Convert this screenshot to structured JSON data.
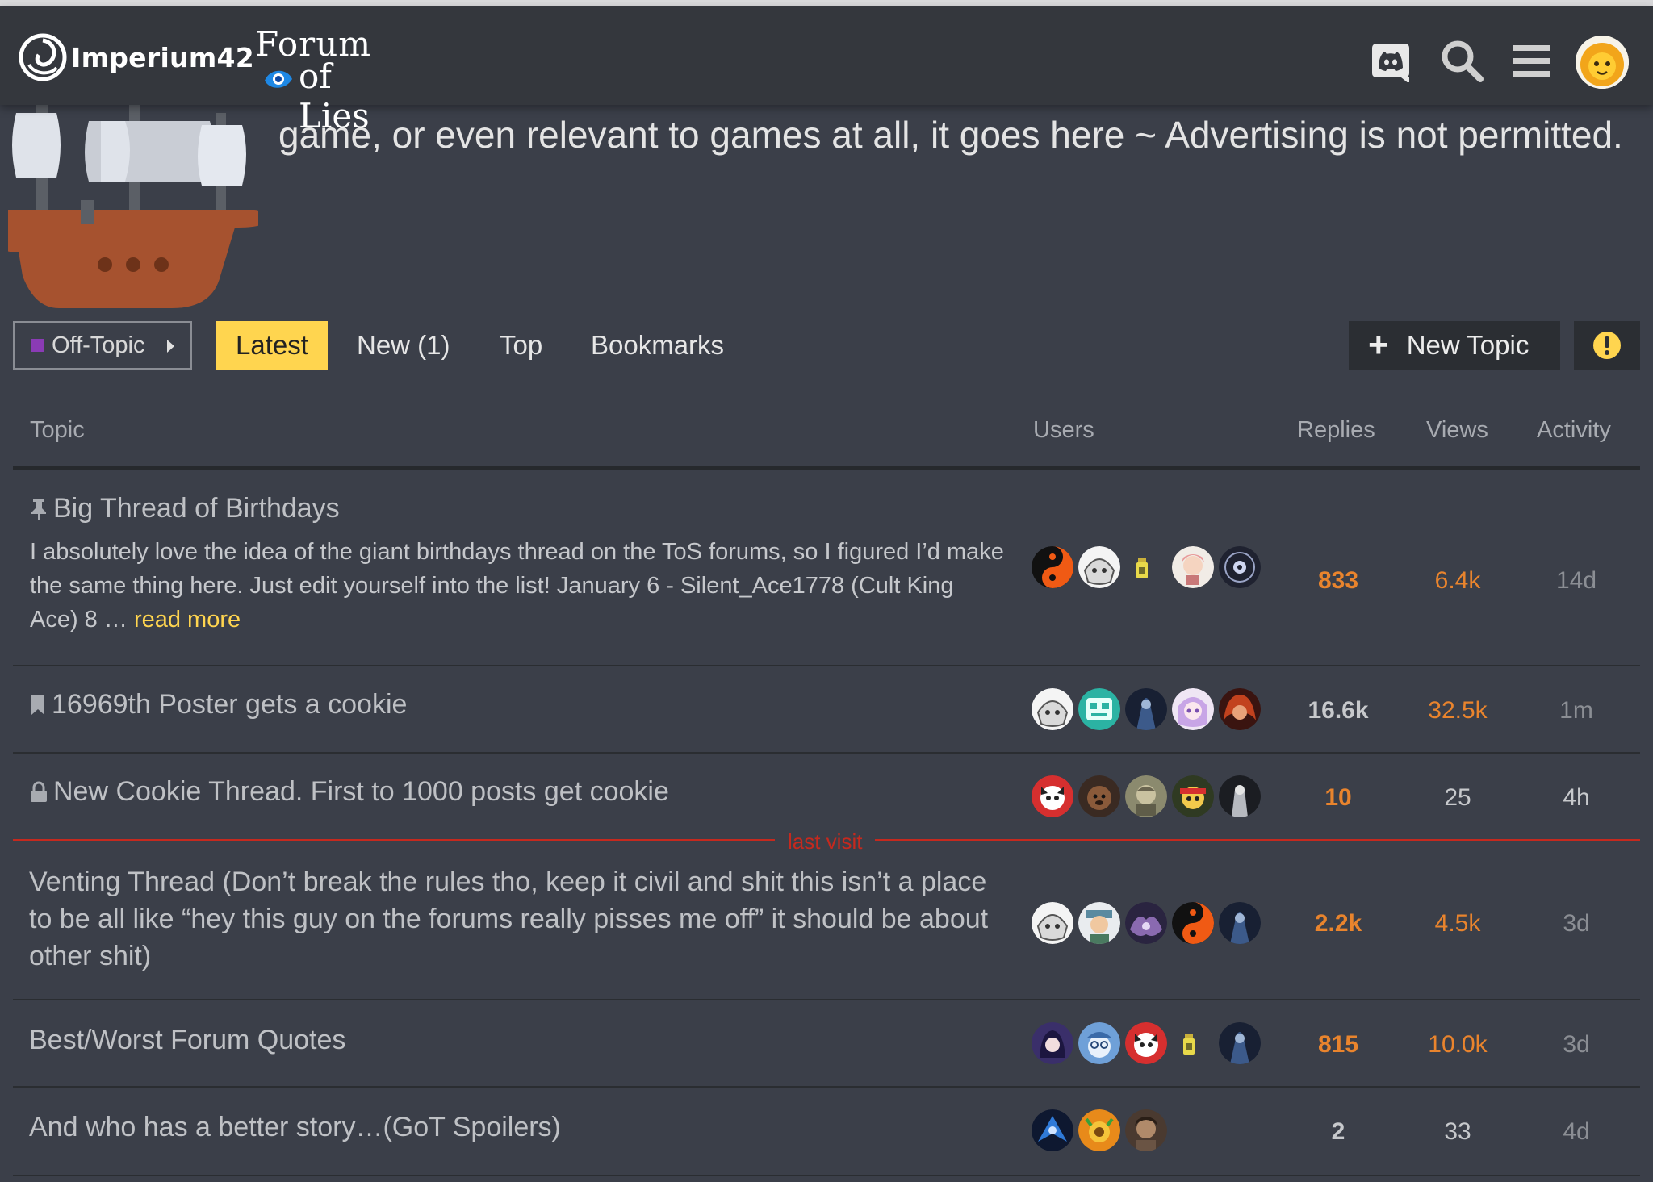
{
  "header": {
    "logo_primary": "Imperium42",
    "logo_secondary_top": "Forum",
    "logo_secondary_bottom": "of Lies",
    "icons": [
      "discord-icon",
      "search-icon",
      "hamburger-menu-icon",
      "user-avatar"
    ]
  },
  "category": {
    "description_visible": "game, or even relevant to games at all, it goes here ~ Advertising is not permitted."
  },
  "nav": {
    "category_dropdown": "Off-Topic",
    "tabs": [
      {
        "label": "Latest",
        "active": true
      },
      {
        "label": "New (1)",
        "active": false
      },
      {
        "label": "Top",
        "active": false
      },
      {
        "label": "Bookmarks",
        "active": false
      }
    ],
    "new_topic_label": "New Topic"
  },
  "table": {
    "headers": {
      "topic": "Topic",
      "users": "Users",
      "replies": "Replies",
      "views": "Views",
      "activity": "Activity"
    },
    "last_visit_label": "last visit",
    "rows": [
      {
        "title": "Big Thread of Birthdays",
        "status_icon": "pin-icon",
        "excerpt": "I absolutely love the idea of the giant birthdays thread on the ToS forums, so I figured I’d make the same thing here. Just edit yourself into the list! January 6 - Silent_Ace1778 (Cult King Ace) 8 …",
        "read_more": "read more",
        "replies": "833",
        "views": "6.4k",
        "activity": "14d"
      },
      {
        "title": "16969th Poster gets a cookie",
        "status_icon": "bookmark-icon",
        "replies": "16.6k",
        "views": "32.5k",
        "activity": "1m"
      },
      {
        "title": "New Cookie Thread. First to 1000 posts get cookie",
        "status_icon": "lock-icon",
        "replies": "10",
        "views": "25",
        "activity": "4h"
      },
      {
        "title": "Venting Thread (Don’t break the rules tho, keep it civil and shit this isn’t a place to be all like “hey this guy on the forums really pisses me off” it should be about other shit)",
        "replies": "2.2k",
        "views": "4.5k",
        "activity": "3d"
      },
      {
        "title": "Best/Worst Forum Quotes",
        "replies": "815",
        "views": "10.0k",
        "activity": "3d"
      },
      {
        "title": "And who has a better story…(GoT Spoilers)",
        "replies": "2",
        "views": "33",
        "activity": "4d"
      }
    ]
  },
  "colors": {
    "background": "#3b3f49",
    "header": "#34373d",
    "accent_yellow": "#ffd54f",
    "hot_orange": "#e9842d",
    "last_visit_red": "#c5291e",
    "category_swatch": "#8a3bb5"
  }
}
